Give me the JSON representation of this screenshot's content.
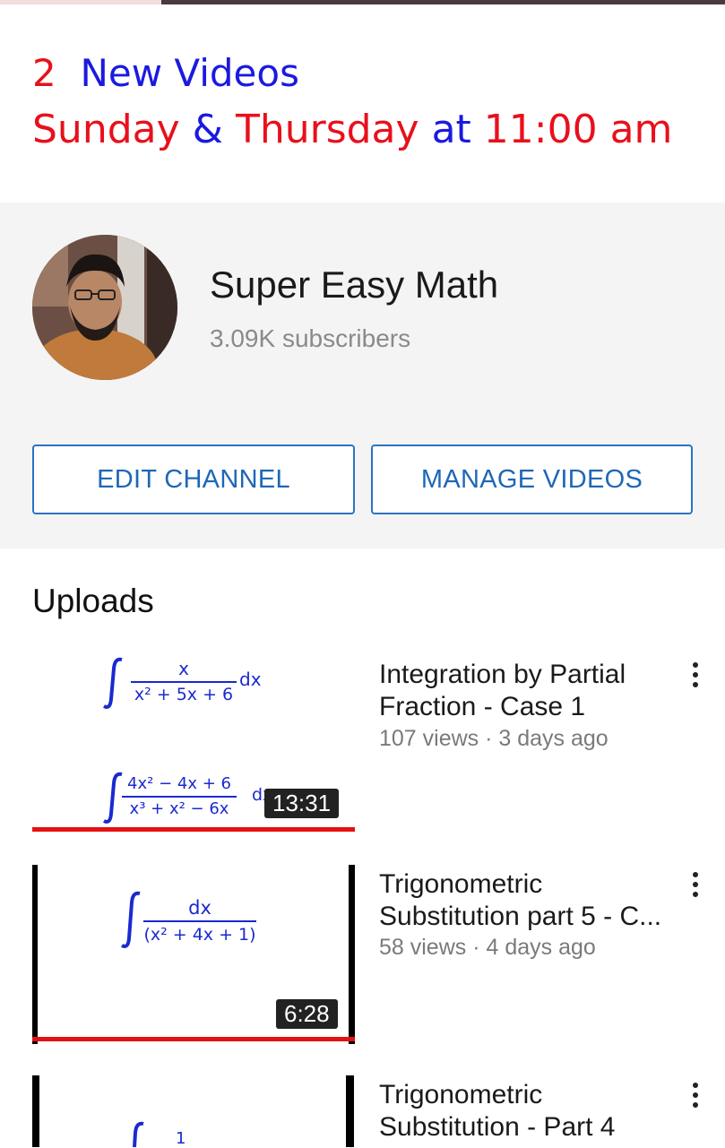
{
  "banner": {
    "line1_number": "2",
    "line1_text": "New Videos",
    "line2_day1": "Sunday",
    "line2_amp": "&",
    "line2_day2": "Thursday",
    "line2_at": "at",
    "line2_time": "11:00 am",
    "colors": {
      "red": "#e8101c",
      "blue": "#1a1ae0"
    }
  },
  "channel": {
    "name": "Super Easy Math",
    "subscribers": "3.09K subscribers",
    "edit_label": "EDIT CHANNEL",
    "manage_label": "MANAGE VIDEOS",
    "accent": "#2a74c2"
  },
  "uploads": {
    "title": "Uploads",
    "videos": [
      {
        "title_line1": "Integration by Partial",
        "title_line2": "Fraction - Case 1",
        "meta": "107 views · 3 days ago",
        "duration": "13:31",
        "watched_fraction": 1.0,
        "thumb_eq1_num": "x",
        "thumb_eq1_den": "x² + 5x + 6",
        "thumb_eq2_num": "4x² − 4x + 6",
        "thumb_eq2_den": "x³ + x² − 6x",
        "thumb_dx": "dx",
        "thumb_dx2": "dx"
      },
      {
        "title_line1": "Trigonometric",
        "title_line2": "Substitution part 5 - C...",
        "meta": "58 views · 4 days ago",
        "duration": "6:28",
        "watched_fraction": 1.0,
        "thumb_eq1_num": "dx",
        "thumb_eq1_den": "(x² + 4x + 1)"
      },
      {
        "title_line1": "Trigonometric",
        "title_line2": "Substitution - Part 4",
        "thumb_eq1_num": "1"
      }
    ]
  },
  "icons": [
    "more-vert-icon",
    "integral-symbol"
  ]
}
